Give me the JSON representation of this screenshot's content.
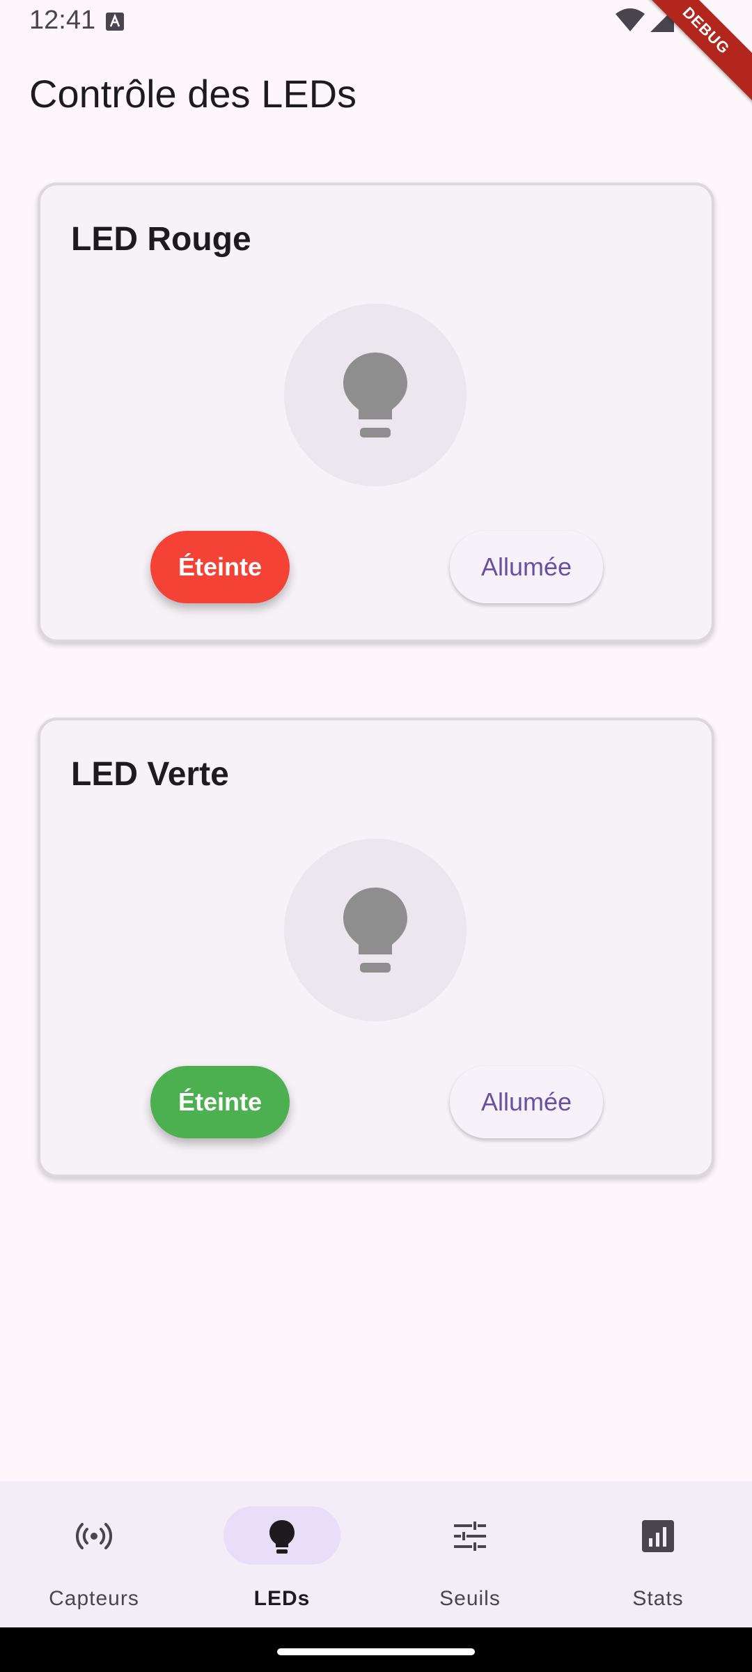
{
  "status_bar": {
    "time": "12:41",
    "icons": [
      "a-notification-icon",
      "wifi-icon",
      "signal-icon",
      "battery-icon"
    ]
  },
  "debug_banner": "DEBUG",
  "app_bar": {
    "title": "Contrôle des LEDs"
  },
  "leds": [
    {
      "title": "LED Rouge",
      "icon": "lightbulb-icon",
      "off_label": "Éteinte",
      "on_label": "Allumée",
      "accent": "#F44336",
      "state": "off"
    },
    {
      "title": "LED Verte",
      "icon": "lightbulb-icon",
      "off_label": "Éteinte",
      "on_label": "Allumée",
      "accent": "#4CAF50",
      "state": "off"
    }
  ],
  "colors": {
    "background": "#FDF7FC",
    "card": "#F6F2F7",
    "primary": "#6750A4",
    "bulb_off": "#8E8E8E",
    "nav_indicator": "#E8DEF8"
  },
  "bottom_nav": {
    "active_index": 1,
    "items": [
      {
        "label": "Capteurs",
        "icon": "sensors-icon"
      },
      {
        "label": "LEDs",
        "icon": "lightbulb-icon"
      },
      {
        "label": "Seuils",
        "icon": "tune-icon"
      },
      {
        "label": "Stats",
        "icon": "bar-chart-icon"
      }
    ]
  }
}
